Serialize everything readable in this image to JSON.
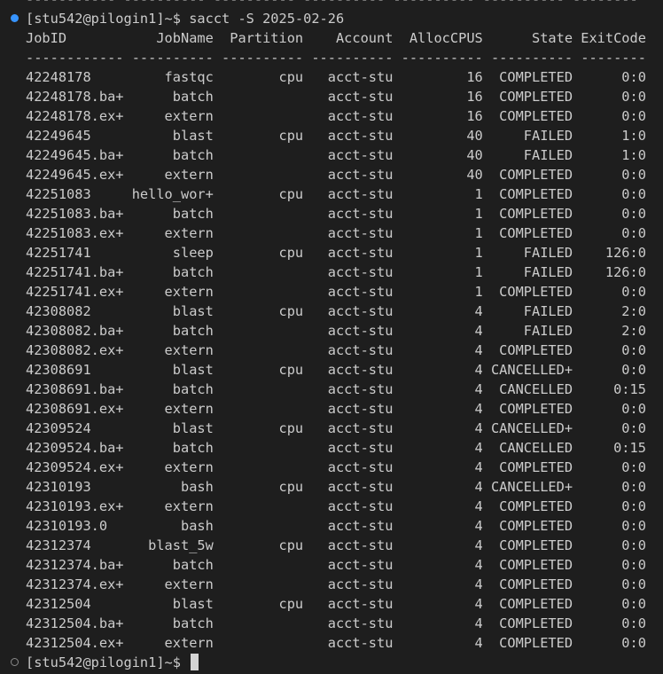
{
  "terminal": {
    "top_clipped_line": "----------- ---------- ---------- ---------- ---------- ---------- --------",
    "prompt": "[stu542@pilogin1]~$ ",
    "command": "sacct -S 2025-02-26",
    "header": "JobID           JobName  Partition    Account  AllocCPUS      State ExitCode",
    "separator": "------------ ---------- ---------- ---------- ---------- ---------- --------",
    "rows": [
      "42248178         fastqc        cpu   acct-stu         16  COMPLETED      0:0",
      "42248178.ba+      batch              acct-stu         16  COMPLETED      0:0",
      "42248178.ex+     extern              acct-stu         16  COMPLETED      0:0",
      "42249645          blast        cpu   acct-stu         40     FAILED      1:0",
      "42249645.ba+      batch              acct-stu         40     FAILED      1:0",
      "42249645.ex+     extern              acct-stu         40  COMPLETED      0:0",
      "42251083     hello_wor+        cpu   acct-stu          1  COMPLETED      0:0",
      "42251083.ba+      batch              acct-stu          1  COMPLETED      0:0",
      "42251083.ex+     extern              acct-stu          1  COMPLETED      0:0",
      "42251741          sleep        cpu   acct-stu          1     FAILED    126:0",
      "42251741.ba+      batch              acct-stu          1     FAILED    126:0",
      "42251741.ex+     extern              acct-stu          1  COMPLETED      0:0",
      "42308082          blast        cpu   acct-stu          4     FAILED      2:0",
      "42308082.ba+      batch              acct-stu          4     FAILED      2:0",
      "42308082.ex+     extern              acct-stu          4  COMPLETED      0:0",
      "42308691          blast        cpu   acct-stu          4 CANCELLED+      0:0",
      "42308691.ba+      batch              acct-stu          4  CANCELLED     0:15",
      "42308691.ex+     extern              acct-stu          4  COMPLETED      0:0",
      "42309524          blast        cpu   acct-stu          4 CANCELLED+      0:0",
      "42309524.ba+      batch              acct-stu          4  CANCELLED     0:15",
      "42309524.ex+     extern              acct-stu          4  COMPLETED      0:0",
      "42310193           bash        cpu   acct-stu          4 CANCELLED+      0:0",
      "42310193.ex+     extern              acct-stu          4  COMPLETED      0:0",
      "42310193.0         bash              acct-stu          4  COMPLETED      0:0",
      "42312374       blast_5w        cpu   acct-stu          4  COMPLETED      0:0",
      "42312374.ba+      batch              acct-stu          4  COMPLETED      0:0",
      "42312374.ex+     extern              acct-stu          4  COMPLETED      0:0",
      "42312504          blast        cpu   acct-stu          4  COMPLETED      0:0",
      "42312504.ba+      batch              acct-stu          4  COMPLETED      0:0",
      "42312504.ex+     extern              acct-stu          4  COMPLETED      0:0"
    ],
    "final_prompt": "[stu542@pilogin1]~$ ",
    "colors": {
      "background": "#1e1e1e",
      "text": "#cccccc",
      "success_dot": "#3794ff",
      "idle_dot": "#8a8a8a"
    }
  }
}
